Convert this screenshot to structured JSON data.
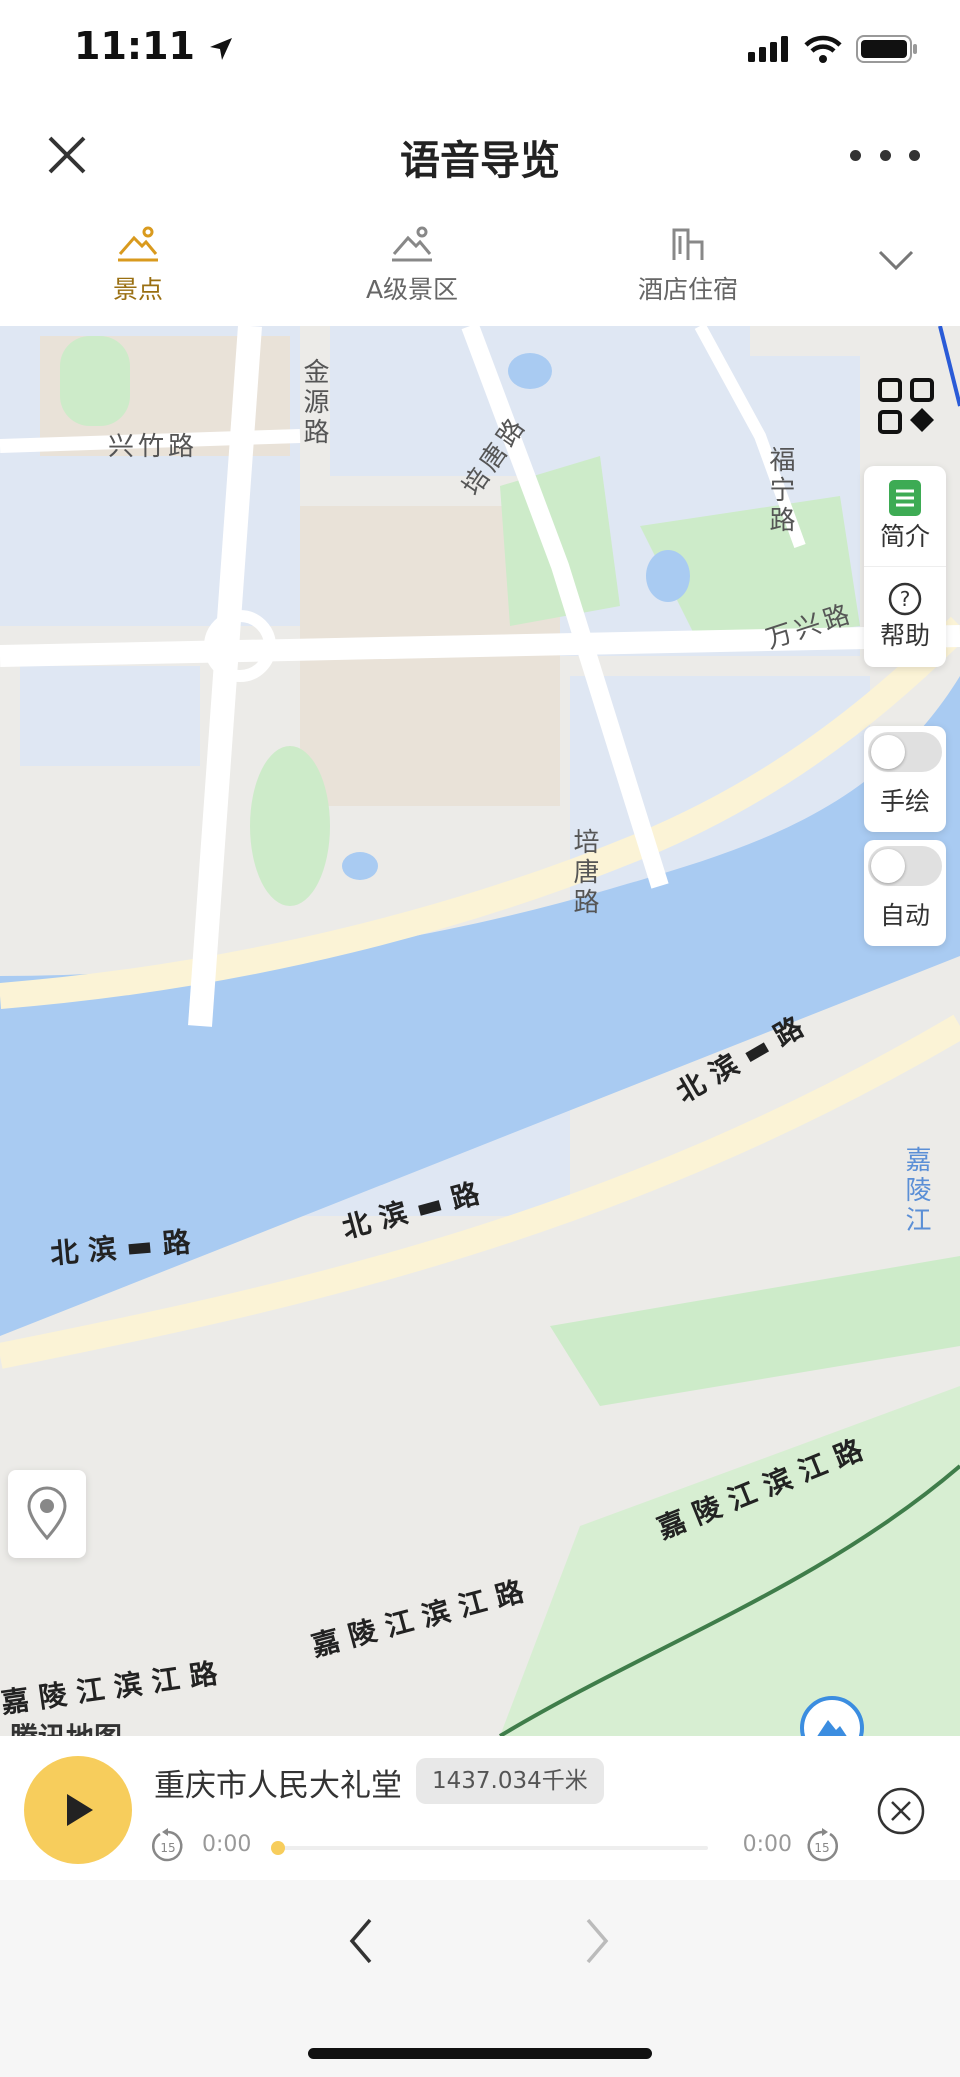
{
  "status_bar": {
    "time": "11:11"
  },
  "nav": {
    "title": "语音导览"
  },
  "tabs": [
    {
      "label": "景点",
      "active": true
    },
    {
      "label": "A级景区",
      "active": false
    },
    {
      "label": "酒店住宿",
      "active": false
    }
  ],
  "side_panel": {
    "intro_label": "简介",
    "help_label": "帮助"
  },
  "toggles": {
    "manual_label": "手绘",
    "auto_label": "自动"
  },
  "map": {
    "road_labels": [
      "兴竹路",
      "金源路",
      "培唐路",
      "福宁路",
      "万兴路",
      "培唐路",
      "北滨▬路",
      "北滨▬路",
      "北滨▬路",
      "嘉陵江滨江路",
      "嘉陵江滨江路",
      "嘉陵江滨江路",
      "嘉陵江"
    ],
    "logo_text": "腾讯地图"
  },
  "player": {
    "title": "重庆市人民大礼堂",
    "distance": "1437.034千米",
    "time_start": "0:00",
    "time_end": "0:00",
    "progress": 0,
    "skip_back_label": "15",
    "skip_forward_label": "15"
  },
  "colors": {
    "accent": "#f7cd5c",
    "river": "#a9cbf2",
    "residential": "#dfe7f3",
    "park": "#cdebc9"
  }
}
